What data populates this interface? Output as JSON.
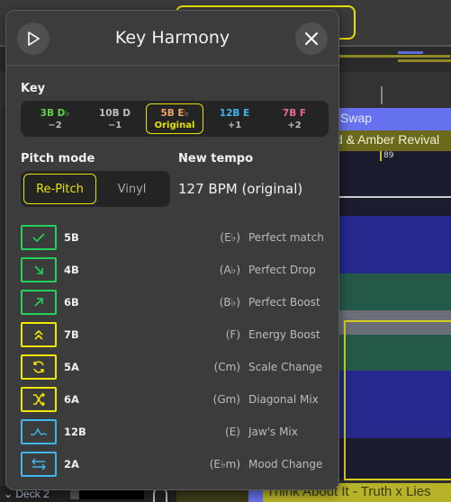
{
  "background": {
    "lane_1": "Swap",
    "lane_2": "d & Amber Revival",
    "beat_marker": "89",
    "deck_label": "Deck 2",
    "track_title": "Think About It - Truth x Lies"
  },
  "dialog": {
    "title": "Key Harmony",
    "play_icon": "play-icon",
    "close_icon": "close-icon",
    "key_label": "Key",
    "keys": [
      {
        "name": "3B D♭",
        "offset": "−2",
        "color": "#5fd44a",
        "selected": false
      },
      {
        "name": "10B D",
        "offset": "−1",
        "color": "#bdbdbd",
        "selected": false
      },
      {
        "name": "5B E♭",
        "offset": "Original",
        "color": "#e8a46a",
        "selected": true
      },
      {
        "name": "12B E",
        "offset": "+1",
        "color": "#3db7ec",
        "selected": false
      },
      {
        "name": "7B F",
        "offset": "+2",
        "color": "#e8689a",
        "selected": false
      }
    ],
    "pitch_mode_label": "Pitch mode",
    "pitch_modes": [
      {
        "label": "Re-Pitch",
        "active": true
      },
      {
        "label": "Vinyl",
        "active": false
      }
    ],
    "new_tempo_label": "New tempo",
    "new_tempo_value": "127 BPM (original)",
    "accent_color": "#e8e200",
    "suggestions": [
      {
        "icon": "check-icon",
        "code": "5B",
        "note": "(E♭)",
        "desc": "Perfect match",
        "color": "#22d25a"
      },
      {
        "icon": "arrow-down-right-icon",
        "code": "4B",
        "note": "(A♭)",
        "desc": "Perfect Drop",
        "color": "#22d25a"
      },
      {
        "icon": "arrow-up-right-icon",
        "code": "6B",
        "note": "(B♭)",
        "desc": "Perfect Boost",
        "color": "#22d25a"
      },
      {
        "icon": "double-chevron-up-icon",
        "code": "7B",
        "note": "(F)",
        "desc": "Energy Boost",
        "color": "#f0e800"
      },
      {
        "icon": "refresh-icon",
        "code": "5A",
        "note": "(Cm)",
        "desc": "Scale Change",
        "color": "#f0e800"
      },
      {
        "icon": "shuffle-icon",
        "code": "6A",
        "note": "(Gm)",
        "desc": "Diagonal Mix",
        "color": "#f0e800"
      },
      {
        "icon": "wave-icon",
        "code": "12B",
        "note": "(E)",
        "desc": "Jaw's Mix",
        "color": "#3db7ec"
      },
      {
        "icon": "swap-arrows-icon",
        "code": "2A",
        "note": "(E♭m)",
        "desc": "Mood Change",
        "color": "#3db7ec"
      }
    ]
  }
}
